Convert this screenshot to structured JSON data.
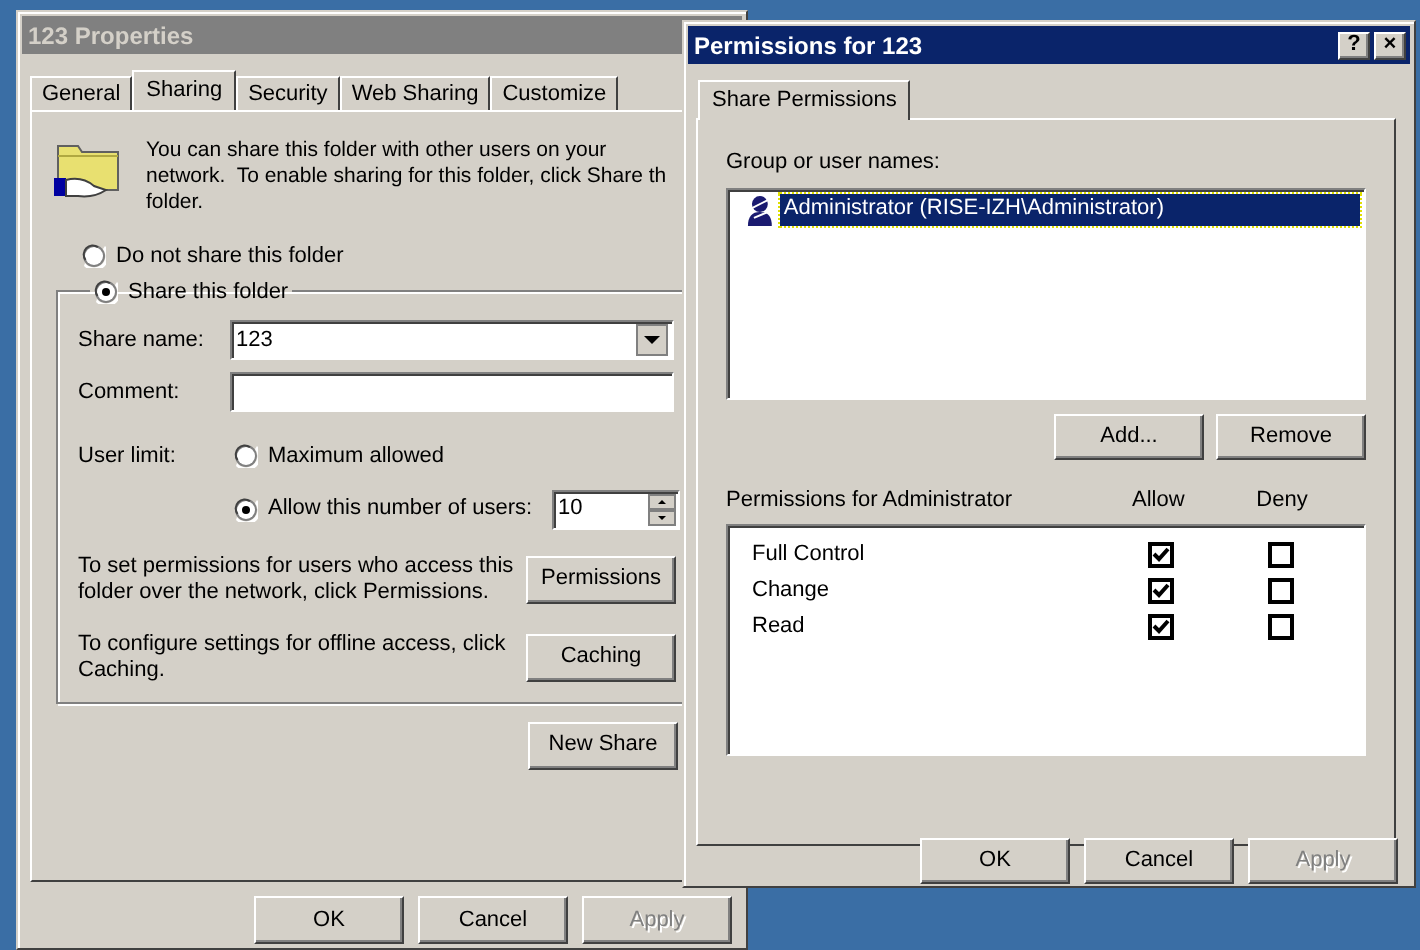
{
  "properties_window": {
    "title": "123 Properties",
    "active": false,
    "tabs": [
      {
        "label": "General",
        "selected": false
      },
      {
        "label": "Sharing",
        "selected": true
      },
      {
        "label": "Security",
        "selected": false
      },
      {
        "label": "Web Sharing",
        "selected": false
      },
      {
        "label": "Customize",
        "selected": false
      }
    ],
    "intro": "You can share this folder with other users on your\nnetwork.  To enable sharing for this folder, click Share th\nfolder.",
    "share_options": [
      {
        "label": "Do not share this folder",
        "selected": false
      },
      {
        "label": "Share this folder",
        "selected": true
      }
    ],
    "share_name": {
      "label": "Share name:",
      "value": "123"
    },
    "comment": {
      "label": "Comment:"
    },
    "user_limit": {
      "label": "User limit:",
      "options": [
        {
          "label": "Maximum allowed",
          "selected": false
        },
        {
          "label": "Allow this number of users:",
          "selected": true
        }
      ],
      "value": "10"
    },
    "permissions_note": "To set permissions for users who access this\nfolder over the network, click Permissions.",
    "permissions_button": "Permissions",
    "caching_note": "To configure settings for offline access, click\nCaching.",
    "caching_button": "Caching",
    "new_share_button": "New Share",
    "buttons": [
      {
        "label": "OK",
        "disabled": false
      },
      {
        "label": "Cancel",
        "disabled": false
      },
      {
        "label": "Apply",
        "disabled": true
      }
    ]
  },
  "permissions_window": {
    "title": "Permissions for 123",
    "active": true,
    "title_buttons": [
      "?",
      "×"
    ],
    "tabs": [
      {
        "label": "Share Permissions",
        "selected": true
      }
    ],
    "group_label": "Group or user names:",
    "users": [
      {
        "name": "Administrator (RISE-IZH\\Administrator)",
        "selected": true
      }
    ],
    "user_buttons": [
      "Add...",
      "Remove"
    ],
    "permissions_label": "Permissions for Administrator",
    "columns": [
      "Allow",
      "Deny"
    ],
    "permissions": [
      {
        "name": "Full Control",
        "allow": true,
        "deny": false
      },
      {
        "name": "Change",
        "allow": true,
        "deny": false
      },
      {
        "name": "Read",
        "allow": true,
        "deny": false
      }
    ],
    "buttons": [
      {
        "label": "OK",
        "disabled": false
      },
      {
        "label": "Cancel",
        "disabled": false
      },
      {
        "label": "Apply",
        "disabled": true
      }
    ]
  }
}
